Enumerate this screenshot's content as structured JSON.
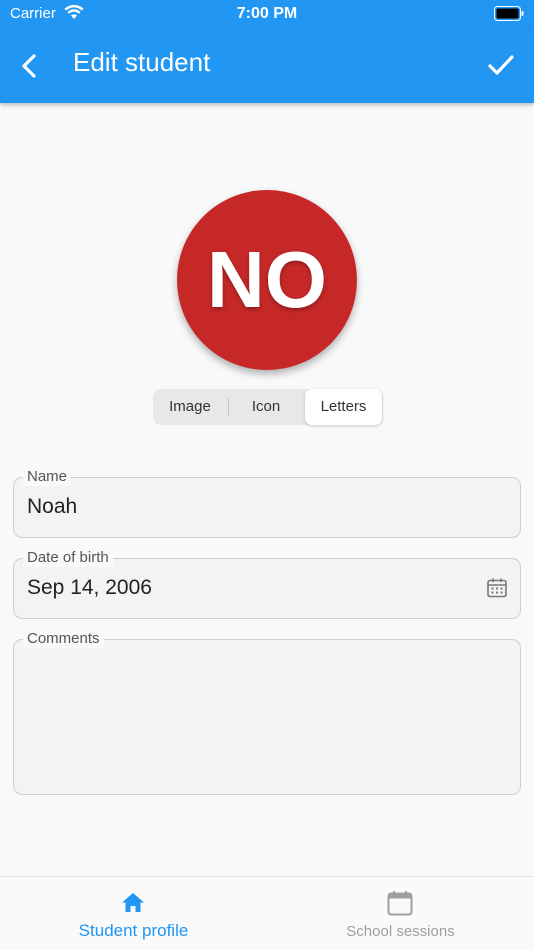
{
  "status_bar": {
    "carrier": "Carrier",
    "time": "7:00 PM"
  },
  "app_bar": {
    "title": "Edit student",
    "color": "#2196f3"
  },
  "avatar": {
    "letters": "NO",
    "color": "#c62828"
  },
  "avatar_type": {
    "options": [
      "Image",
      "Icon",
      "Letters"
    ],
    "selected": "Letters"
  },
  "form": {
    "name": {
      "label": "Name",
      "value": "Noah"
    },
    "dob": {
      "label": "Date of birth",
      "value": "Sep 14, 2006"
    },
    "comments": {
      "label": "Comments",
      "value": ""
    }
  },
  "bottom_nav": {
    "items": [
      {
        "label": "Student profile",
        "icon": "home-icon",
        "active": true
      },
      {
        "label": "School sessions",
        "icon": "calendar-icon",
        "active": false
      }
    ],
    "active_color": "#2196f3",
    "inactive_color": "#9e9e9e"
  }
}
